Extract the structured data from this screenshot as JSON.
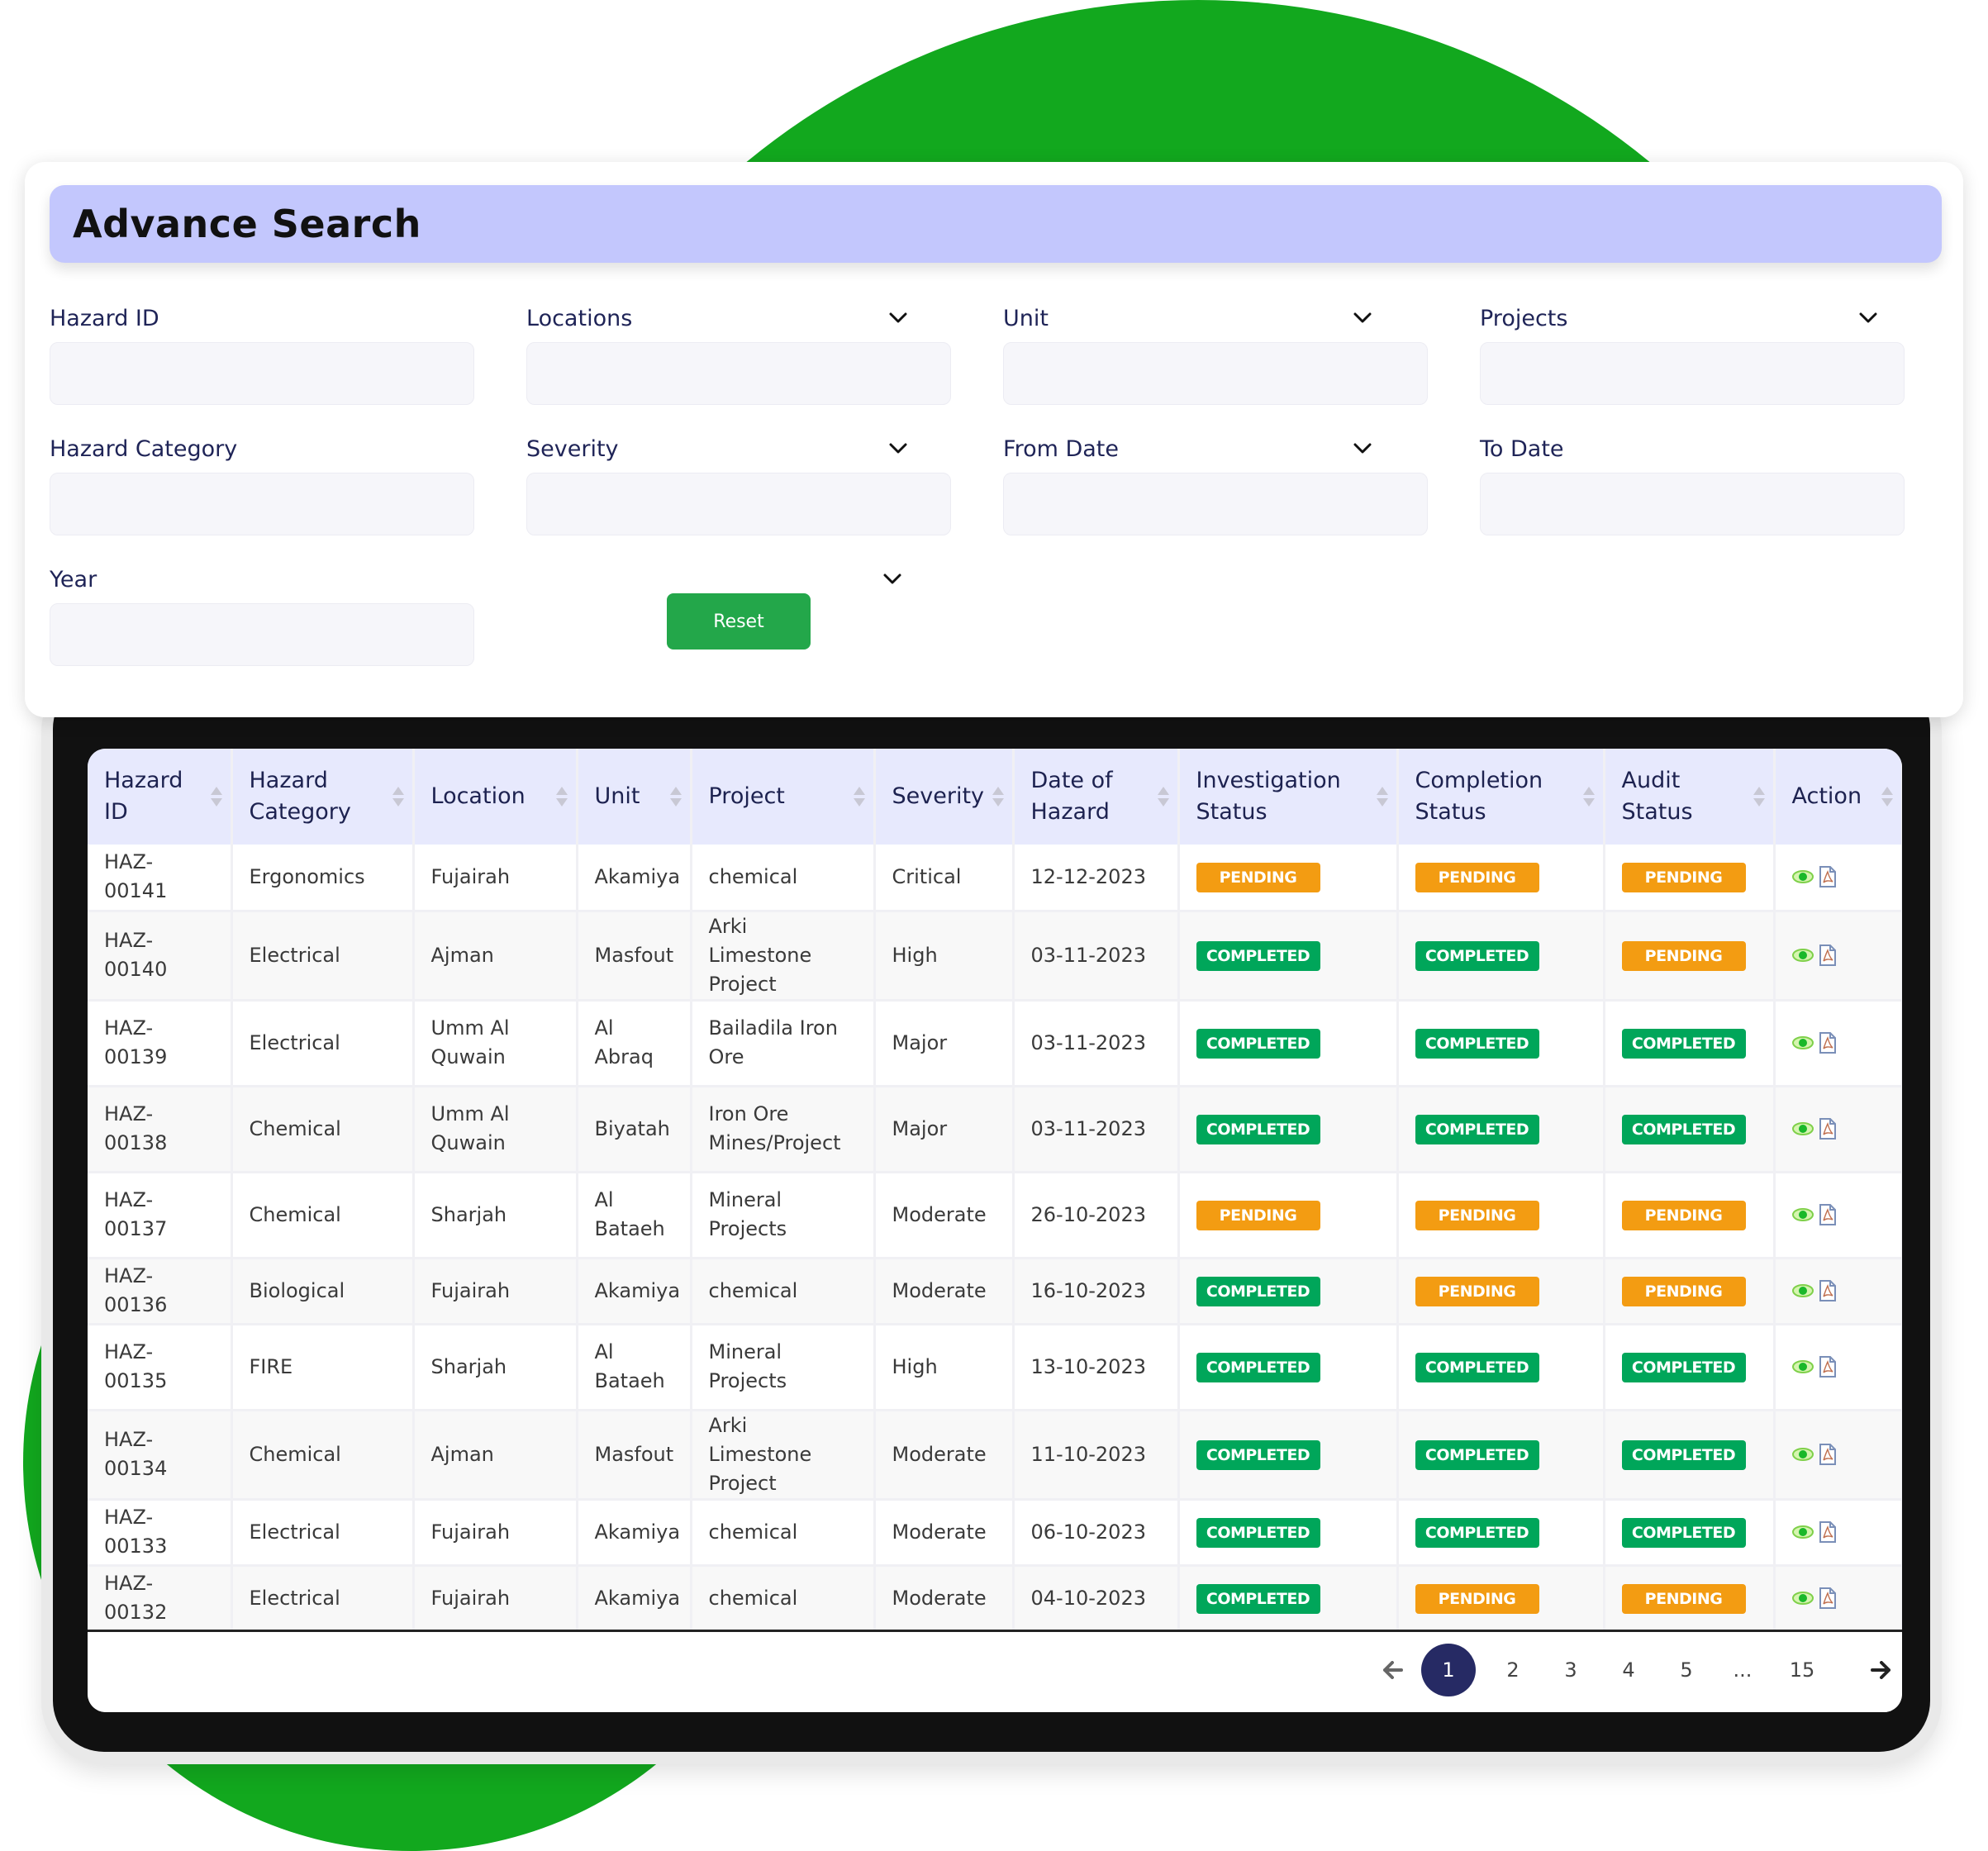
{
  "search": {
    "title": "Advance Search",
    "fields": [
      {
        "label": "Hazard ID",
        "value": "",
        "dropdown": false
      },
      {
        "label": "Locations",
        "value": "",
        "dropdown": true
      },
      {
        "label": "Unit",
        "value": "",
        "dropdown": true
      },
      {
        "label": "Projects",
        "value": "",
        "dropdown": true
      },
      {
        "label": "Hazard Category",
        "value": "",
        "dropdown": false
      },
      {
        "label": "Severity",
        "value": "",
        "dropdown": true
      },
      {
        "label": "From Date",
        "value": "",
        "dropdown": true
      },
      {
        "label": "To Date",
        "value": "",
        "dropdown": false
      },
      {
        "label": "Year",
        "value": "",
        "dropdown": true
      }
    ],
    "reset_label": "Reset"
  },
  "table": {
    "columns": [
      "Hazard ID",
      "Hazard Category",
      "Location",
      "Unit",
      "Project",
      "Severity",
      "Date of Hazard",
      "Investigation Status",
      "Completion Status",
      "Audit Status",
      "Action"
    ],
    "rows": [
      {
        "id": "HAZ-00141",
        "category": "Ergonomics",
        "location": "Fujairah",
        "unit": "Akamiya",
        "project": "chemical",
        "severity": "Critical",
        "date": "12-12-2023",
        "investigation": "PENDING",
        "completion": "PENDING",
        "audit": "PENDING"
      },
      {
        "id": "HAZ-00140",
        "category": "Electrical",
        "location": "Ajman",
        "unit": "Masfout",
        "project": "Arki Limestone Project",
        "severity": "High",
        "date": "03-11-2023",
        "investigation": "COMPLETED",
        "completion": "COMPLETED",
        "audit": "PENDING"
      },
      {
        "id": "HAZ-00139",
        "category": "Electrical",
        "location": "Umm Al Quwain",
        "unit": "Al Abraq",
        "project": "Bailadila Iron Ore",
        "severity": "Major",
        "date": "03-11-2023",
        "investigation": "COMPLETED",
        "completion": "COMPLETED",
        "audit": "COMPLETED"
      },
      {
        "id": "HAZ-00138",
        "category": "Chemical",
        "location": "Umm Al Quwain",
        "unit": "Biyatah",
        "project": "Iron Ore Mines/Project",
        "severity": "Major",
        "date": "03-11-2023",
        "investigation": "COMPLETED",
        "completion": "COMPLETED",
        "audit": "COMPLETED"
      },
      {
        "id": "HAZ-00137",
        "category": "Chemical",
        "location": "Sharjah",
        "unit": "Al Bataeh",
        "project": "Mineral Projects",
        "severity": "Moderate",
        "date": "26-10-2023",
        "investigation": "PENDING",
        "completion": "PENDING",
        "audit": "PENDING"
      },
      {
        "id": "HAZ-00136",
        "category": "Biological",
        "location": "Fujairah",
        "unit": "Akamiya",
        "project": "chemical",
        "severity": "Moderate",
        "date": "16-10-2023",
        "investigation": "COMPLETED",
        "completion": "PENDING",
        "audit": "PENDING"
      },
      {
        "id": "HAZ-00135",
        "category": "FIRE",
        "location": "Sharjah",
        "unit": "Al Bataeh",
        "project": "Mineral Projects",
        "severity": "High",
        "date": "13-10-2023",
        "investigation": "COMPLETED",
        "completion": "COMPLETED",
        "audit": "COMPLETED"
      },
      {
        "id": "HAZ-00134",
        "category": "Chemical",
        "location": "Ajman",
        "unit": "Masfout",
        "project": "Arki Limestone Project",
        "severity": "Moderate",
        "date": "11-10-2023",
        "investigation": "COMPLETED",
        "completion": "COMPLETED",
        "audit": "COMPLETED"
      },
      {
        "id": "HAZ-00133",
        "category": "Electrical",
        "location": "Fujairah",
        "unit": "Akamiya",
        "project": "chemical",
        "severity": "Moderate",
        "date": "06-10-2023",
        "investigation": "COMPLETED",
        "completion": "COMPLETED",
        "audit": "COMPLETED"
      },
      {
        "id": "HAZ-00132",
        "category": "Electrical",
        "location": "Fujairah",
        "unit": "Akamiya",
        "project": "chemical",
        "severity": "Moderate",
        "date": "04-10-2023",
        "investigation": "COMPLETED",
        "completion": "PENDING",
        "audit": "PENDING"
      }
    ],
    "actions": [
      {
        "icon": "eye-icon",
        "label": "view"
      },
      {
        "icon": "pdf-icon",
        "label": "download-pdf"
      }
    ]
  },
  "pagination": {
    "prev_icon": "arrow-left-icon",
    "next_icon": "arrow-right-icon",
    "pages": [
      "1",
      "2",
      "3",
      "4",
      "5",
      "...",
      "15"
    ],
    "current": "1"
  },
  "colors": {
    "brand_green": "#12a81e",
    "header_bar": "#c3c7fd",
    "table_header": "#e7e9fd",
    "pending": "#f39c12",
    "completed": "#00a65a",
    "reset_button": "#23a74a",
    "active_page": "#262a64"
  }
}
